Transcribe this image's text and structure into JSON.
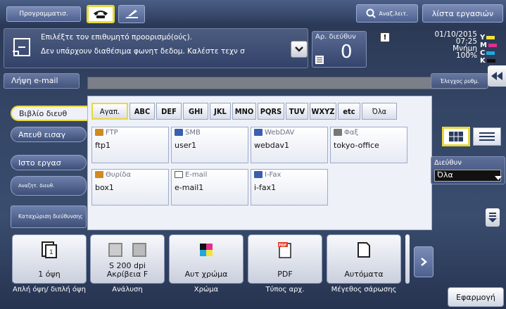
{
  "header": {
    "program_label": "Προγραμματισ.",
    "search_label": "Αναζ.λειτ.",
    "job_list_label": "λίστα εργασιών"
  },
  "message": {
    "line1": "Επιλέξτε τον επιθυμητό προορισμό(ούς).",
    "line2": "Δεν υπάρχουν διαθέσιμα φωνητ δεδομ. Καλέστε τεχν σ"
  },
  "dest_count": {
    "label": "Αρ. διεύθυν",
    "value": "0"
  },
  "status": {
    "warning": "!",
    "date": "01/10/2015",
    "time": "07:25",
    "memory_label": "Μνήμη",
    "memory_value": "100%",
    "toner": [
      {
        "letter": "Y",
        "color": "#f2e23a"
      },
      {
        "letter": "M",
        "color": "#e0308f"
      },
      {
        "letter": "C",
        "color": "#22a7e0"
      },
      {
        "letter": "K",
        "color": "#111111"
      }
    ]
  },
  "email_button": "Λήψη e-mail",
  "check_button": "Έλεγχος ρυθμ.",
  "side_tabs": [
    "Βιβλίο διευθ",
    "Απευθ εισαγ",
    "Ιστο εργασ",
    "Αναζητ. διευθ.",
    "Καταχώριση διεύθυνσης"
  ],
  "alpha_tabs": [
    "Αγαπ.",
    "ABC",
    "DEF",
    "GHI",
    "JKL",
    "MNO",
    "PQRS",
    "TUV",
    "WXYZ",
    "etc",
    "Όλα"
  ],
  "entries": [
    {
      "type": "FTP",
      "name": "ftp1",
      "icon_color": "#d08a20"
    },
    {
      "type": "SMB",
      "name": "user1",
      "icon_color": "#3a5fb0"
    },
    {
      "type": "WebDAV",
      "name": "webdav1",
      "icon_color": "#3a5fb0"
    },
    {
      "type": "Φαξ",
      "name": "tokyo-office",
      "icon_color": "#777777"
    },
    {
      "type": "Θυρίδα",
      "name": "box1",
      "icon_color": "#d08a20"
    },
    {
      "type": "E-mail",
      "name": "e-mail1",
      "icon_color": "#888888"
    },
    {
      "type": "I-Fax",
      "name": "i-fax1",
      "icon_color": "#3a5fb0"
    }
  ],
  "addr_filter": {
    "label": "Διεύθυν",
    "value": "Όλα"
  },
  "functions": [
    {
      "value": "1 όψη",
      "label": "Απλή όψη/ διπλή όψη",
      "icon": "simplex-icon"
    },
    {
      "value": "S 200 dpi Ακρίβεια F",
      "label": "Ανάλυση",
      "icon": "resolution-icon"
    },
    {
      "value": "Αυτ χρώμα",
      "label": "Χρώμα",
      "icon": "color-icon"
    },
    {
      "value": "PDF",
      "label": "Τύπος αρχ.",
      "icon": "pdf-icon"
    },
    {
      "value": "Αυτόματα",
      "label": "Μέγεθος σάρωσης",
      "icon": "page-size-icon"
    }
  ],
  "apply_button": "Εφαρμογή"
}
